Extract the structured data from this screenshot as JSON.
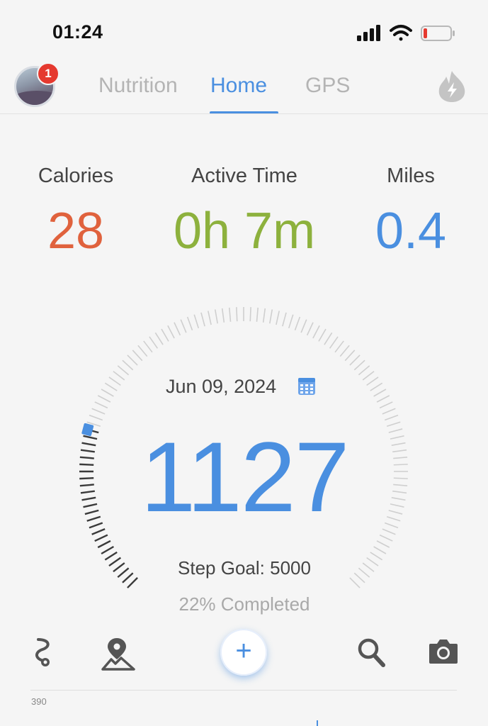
{
  "status_bar": {
    "time": "01:24"
  },
  "nav": {
    "badge_count": "1",
    "tabs": [
      {
        "label": "Nutrition",
        "active": false
      },
      {
        "label": "Home",
        "active": true
      },
      {
        "label": "GPS",
        "active": false
      }
    ]
  },
  "stats": {
    "calories": {
      "label": "Calories",
      "value": "28",
      "color": "#e0623d"
    },
    "active_time": {
      "label": "Active Time",
      "value": "0h 7m",
      "color": "#8db13d"
    },
    "miles": {
      "label": "Miles",
      "value": "0.4",
      "color": "#4a8fe0"
    }
  },
  "steps": {
    "date": "Jun 09, 2024",
    "count": "1127",
    "goal": "Step Goal: 5000",
    "completed": "22% Completed",
    "progress": 0.22
  },
  "toolbar": {
    "icons": [
      "route-icon",
      "map-pin-icon",
      "add-icon",
      "search-icon",
      "camera-icon"
    ],
    "plus_label": "+"
  },
  "chart": {
    "axis_label": "390"
  },
  "colors": {
    "accent": "#4a8fe0"
  }
}
